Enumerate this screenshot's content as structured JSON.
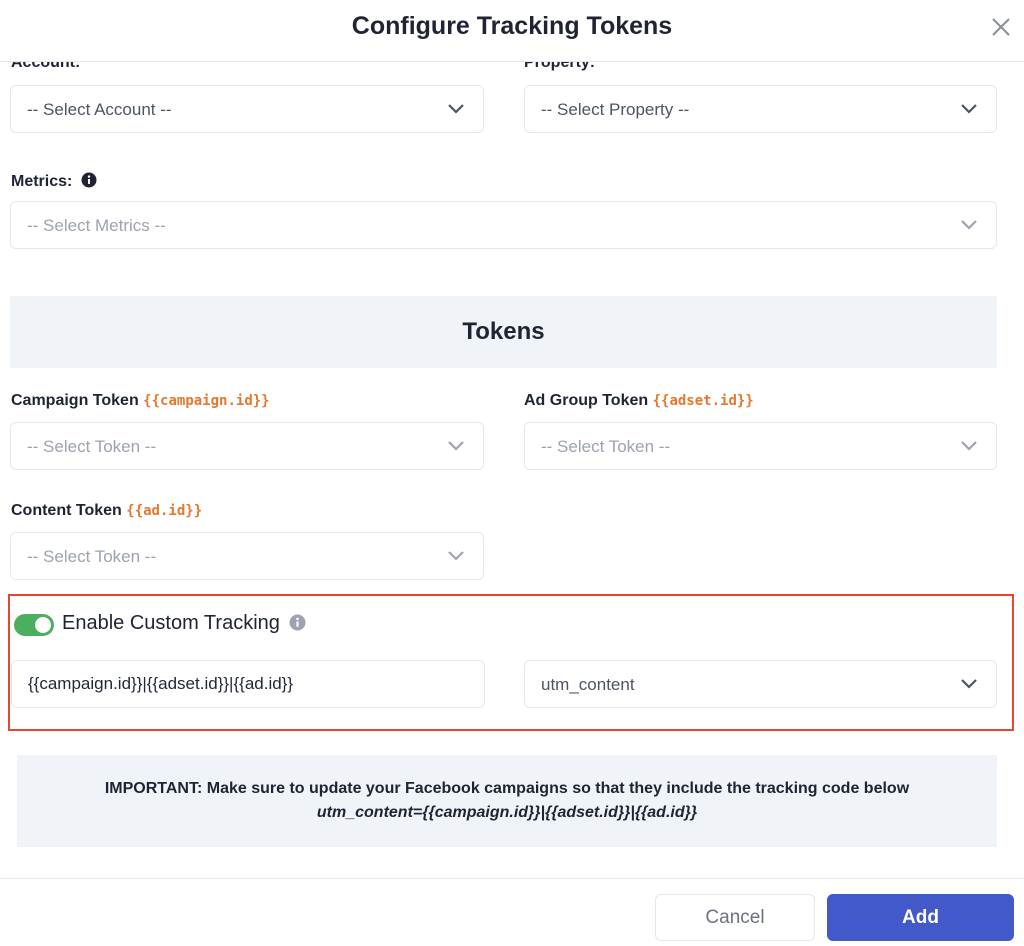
{
  "dialog": {
    "title": "Configure Tracking Tokens",
    "close_icon": "close-x-icon"
  },
  "fields": {
    "account": {
      "label": "Account:",
      "placeholder": "-- Select Account --"
    },
    "property": {
      "label": "Property:",
      "placeholder": "-- Select Property --"
    },
    "metrics": {
      "label": "Metrics:",
      "placeholder": "-- Select Metrics --",
      "icon": "info-circle-icon"
    }
  },
  "tokens": {
    "heading": "Tokens",
    "campaign": {
      "label": "Campaign Token",
      "code": "{{campaign.id}}",
      "placeholder": "-- Select Token --"
    },
    "ad_group": {
      "label": "Ad Group Token",
      "code": "{{adset.id}}",
      "placeholder": "-- Select Token --"
    },
    "content": {
      "label": "Content Token",
      "code": "{{ad.id}}",
      "placeholder": "-- Select Token --"
    }
  },
  "custom_tracking": {
    "label": "Enable Custom Tracking",
    "enabled": true,
    "value": "{{campaign.id}}|{{adset.id}}|{{ad.id}}",
    "parameter": "utm_content",
    "highlight_color": "#e8452e",
    "toggle_color": "#4caf60"
  },
  "notice": {
    "line1": "IMPORTANT: Make sure to update your Facebook campaigns so that they include the tracking code below",
    "line2": "utm_content={{campaign.id}}|{{adset.id}}|{{ad.id}}"
  },
  "footer": {
    "cancel_label": "Cancel",
    "add_label": "Add",
    "accent_color": "#4359c9"
  }
}
